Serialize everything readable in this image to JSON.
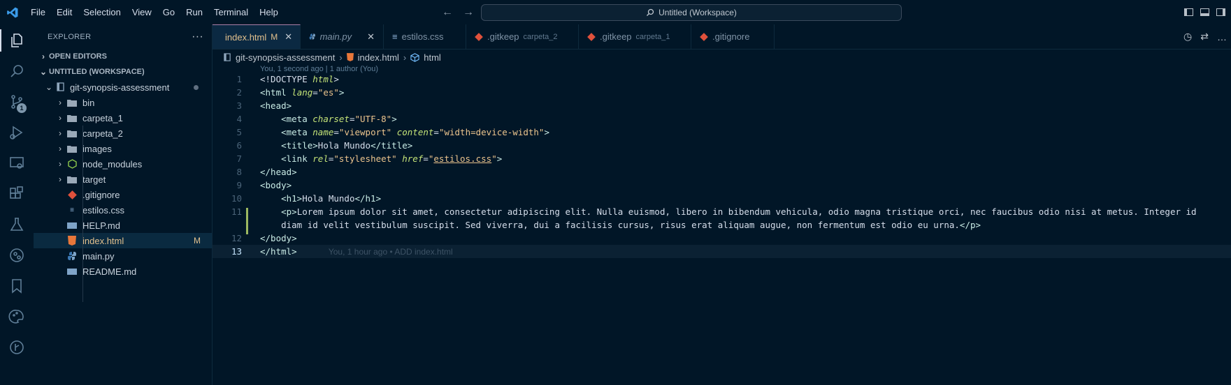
{
  "menu": [
    "File",
    "Edit",
    "Selection",
    "View",
    "Go",
    "Run",
    "Terminal",
    "Help"
  ],
  "command_center": {
    "label": "Untitled (Workspace)"
  },
  "activity": {
    "scm_badge": "1"
  },
  "explorer": {
    "title": "EXPLORER",
    "more": "···",
    "open_editors": "OPEN EDITORS",
    "workspace": "UNTITLED (WORKSPACE)",
    "root": "git-synopsis-assessment",
    "items": [
      {
        "label": "bin",
        "type": "folder"
      },
      {
        "label": "carpeta_1",
        "type": "folder"
      },
      {
        "label": "carpeta_2",
        "type": "folder"
      },
      {
        "label": "images",
        "type": "folder"
      },
      {
        "label": "node_modules",
        "type": "folder"
      },
      {
        "label": "target",
        "type": "folder"
      },
      {
        "label": ".gitignore",
        "type": "git"
      },
      {
        "label": "estilos.css",
        "type": "css"
      },
      {
        "label": "HELP.md",
        "type": "md"
      },
      {
        "label": "index.html",
        "type": "html",
        "badge": "M"
      },
      {
        "label": "main.py",
        "type": "py"
      },
      {
        "label": "README.md",
        "type": "md"
      }
    ]
  },
  "tabs": [
    {
      "label": "index.html",
      "mod": "M",
      "active": true
    },
    {
      "label": "main.py"
    },
    {
      "label": "estilos.css"
    },
    {
      "label": ".gitkeep",
      "dir": "carpeta_2"
    },
    {
      "label": ".gitkeep",
      "dir": "carpeta_1"
    },
    {
      "label": ".gitignore"
    }
  ],
  "breadcrumb": [
    "git-synopsis-assessment",
    "index.html",
    "html"
  ],
  "editor": {
    "codelens": "You, 1 second ago | 1 author (You)",
    "blame": "You, 1 hour ago • ADD index.html",
    "line_numbers": [
      "1",
      "2",
      "3",
      "4",
      "5",
      "6",
      "7",
      "8",
      "9",
      "10",
      "11",
      "",
      "12",
      "13"
    ],
    "p_text": "Lorem ipsum dolor sit amet, consectetur adipiscing elit. Nulla euismod, libero in bibendum vehicula, odio magna tristique orci, nec faucibus odio nisi at metus. Integer id",
    "p_text2": "diam id velit vestibulum suscipit. Sed viverra, dui a facilisis cursus, risus erat aliquam augue, non fermentum est odio eu urna.",
    "title_text": "Hola Mundo",
    "h1_text": "Hola Mundo",
    "lang": "\"es\"",
    "charset": "\"UTF-8\"",
    "viewport_name": "\"viewport\"",
    "viewport_content": "\"width=device-width\"",
    "rel": "\"stylesheet\"",
    "href": "estilos.css"
  }
}
